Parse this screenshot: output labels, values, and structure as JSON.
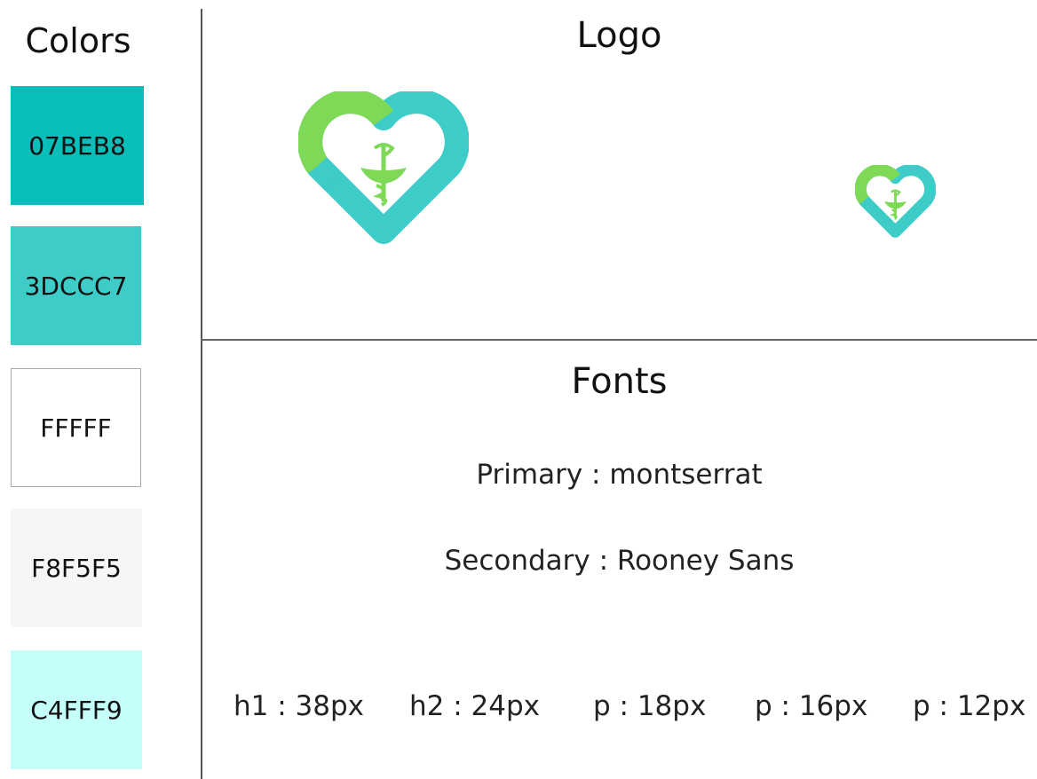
{
  "colors": {
    "title": "Colors",
    "swatches": [
      {
        "label": "07BEB8",
        "hex": "#07BEB8"
      },
      {
        "label": "3DCCC7",
        "hex": "#3DCCC7"
      },
      {
        "label": "FFFFF",
        "hex": "#FFFFFF"
      },
      {
        "label": "F8F5F5",
        "hex": "#F8F5F5"
      },
      {
        "label": "C4FFF9",
        "hex": "#C4FFF9"
      }
    ]
  },
  "logo": {
    "title": "Logo",
    "icon": "heart-caduceus-icon",
    "accent_green": "#7ED957",
    "accent_teal": "#3DCCC7"
  },
  "fonts": {
    "title": "Fonts",
    "primary": "Primary : montserrat",
    "secondary": "Secondary : Rooney Sans",
    "sizes": [
      "h1 : 38px",
      "h2 : 24px",
      "p : 18px",
      "p : 16px",
      "p : 12px"
    ]
  }
}
